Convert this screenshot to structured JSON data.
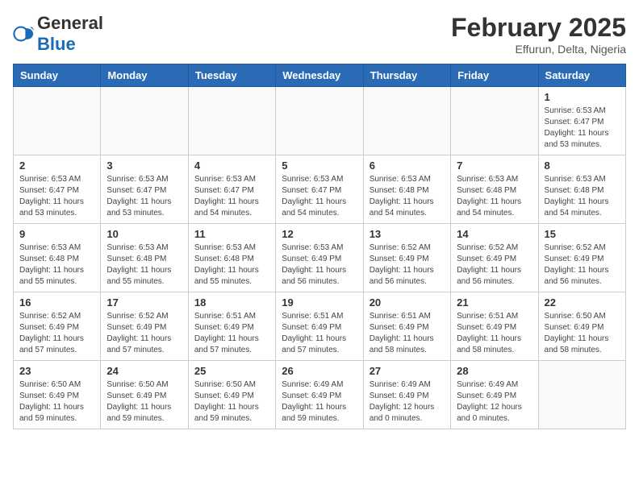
{
  "header": {
    "logo_general": "General",
    "logo_blue": "Blue",
    "month_year": "February 2025",
    "location": "Effurun, Delta, Nigeria"
  },
  "days_of_week": [
    "Sunday",
    "Monday",
    "Tuesday",
    "Wednesday",
    "Thursday",
    "Friday",
    "Saturday"
  ],
  "weeks": [
    [
      {
        "day": "",
        "info": ""
      },
      {
        "day": "",
        "info": ""
      },
      {
        "day": "",
        "info": ""
      },
      {
        "day": "",
        "info": ""
      },
      {
        "day": "",
        "info": ""
      },
      {
        "day": "",
        "info": ""
      },
      {
        "day": "1",
        "info": "Sunrise: 6:53 AM\nSunset: 6:47 PM\nDaylight: 11 hours and 53 minutes."
      }
    ],
    [
      {
        "day": "2",
        "info": "Sunrise: 6:53 AM\nSunset: 6:47 PM\nDaylight: 11 hours and 53 minutes."
      },
      {
        "day": "3",
        "info": "Sunrise: 6:53 AM\nSunset: 6:47 PM\nDaylight: 11 hours and 53 minutes."
      },
      {
        "day": "4",
        "info": "Sunrise: 6:53 AM\nSunset: 6:47 PM\nDaylight: 11 hours and 54 minutes."
      },
      {
        "day": "5",
        "info": "Sunrise: 6:53 AM\nSunset: 6:47 PM\nDaylight: 11 hours and 54 minutes."
      },
      {
        "day": "6",
        "info": "Sunrise: 6:53 AM\nSunset: 6:48 PM\nDaylight: 11 hours and 54 minutes."
      },
      {
        "day": "7",
        "info": "Sunrise: 6:53 AM\nSunset: 6:48 PM\nDaylight: 11 hours and 54 minutes."
      },
      {
        "day": "8",
        "info": "Sunrise: 6:53 AM\nSunset: 6:48 PM\nDaylight: 11 hours and 54 minutes."
      }
    ],
    [
      {
        "day": "9",
        "info": "Sunrise: 6:53 AM\nSunset: 6:48 PM\nDaylight: 11 hours and 55 minutes."
      },
      {
        "day": "10",
        "info": "Sunrise: 6:53 AM\nSunset: 6:48 PM\nDaylight: 11 hours and 55 minutes."
      },
      {
        "day": "11",
        "info": "Sunrise: 6:53 AM\nSunset: 6:48 PM\nDaylight: 11 hours and 55 minutes."
      },
      {
        "day": "12",
        "info": "Sunrise: 6:53 AM\nSunset: 6:49 PM\nDaylight: 11 hours and 56 minutes."
      },
      {
        "day": "13",
        "info": "Sunrise: 6:52 AM\nSunset: 6:49 PM\nDaylight: 11 hours and 56 minutes."
      },
      {
        "day": "14",
        "info": "Sunrise: 6:52 AM\nSunset: 6:49 PM\nDaylight: 11 hours and 56 minutes."
      },
      {
        "day": "15",
        "info": "Sunrise: 6:52 AM\nSunset: 6:49 PM\nDaylight: 11 hours and 56 minutes."
      }
    ],
    [
      {
        "day": "16",
        "info": "Sunrise: 6:52 AM\nSunset: 6:49 PM\nDaylight: 11 hours and 57 minutes."
      },
      {
        "day": "17",
        "info": "Sunrise: 6:52 AM\nSunset: 6:49 PM\nDaylight: 11 hours and 57 minutes."
      },
      {
        "day": "18",
        "info": "Sunrise: 6:51 AM\nSunset: 6:49 PM\nDaylight: 11 hours and 57 minutes."
      },
      {
        "day": "19",
        "info": "Sunrise: 6:51 AM\nSunset: 6:49 PM\nDaylight: 11 hours and 57 minutes."
      },
      {
        "day": "20",
        "info": "Sunrise: 6:51 AM\nSunset: 6:49 PM\nDaylight: 11 hours and 58 minutes."
      },
      {
        "day": "21",
        "info": "Sunrise: 6:51 AM\nSunset: 6:49 PM\nDaylight: 11 hours and 58 minutes."
      },
      {
        "day": "22",
        "info": "Sunrise: 6:50 AM\nSunset: 6:49 PM\nDaylight: 11 hours and 58 minutes."
      }
    ],
    [
      {
        "day": "23",
        "info": "Sunrise: 6:50 AM\nSunset: 6:49 PM\nDaylight: 11 hours and 59 minutes."
      },
      {
        "day": "24",
        "info": "Sunrise: 6:50 AM\nSunset: 6:49 PM\nDaylight: 11 hours and 59 minutes."
      },
      {
        "day": "25",
        "info": "Sunrise: 6:50 AM\nSunset: 6:49 PM\nDaylight: 11 hours and 59 minutes."
      },
      {
        "day": "26",
        "info": "Sunrise: 6:49 AM\nSunset: 6:49 PM\nDaylight: 11 hours and 59 minutes."
      },
      {
        "day": "27",
        "info": "Sunrise: 6:49 AM\nSunset: 6:49 PM\nDaylight: 12 hours and 0 minutes."
      },
      {
        "day": "28",
        "info": "Sunrise: 6:49 AM\nSunset: 6:49 PM\nDaylight: 12 hours and 0 minutes."
      },
      {
        "day": "",
        "info": ""
      }
    ]
  ]
}
